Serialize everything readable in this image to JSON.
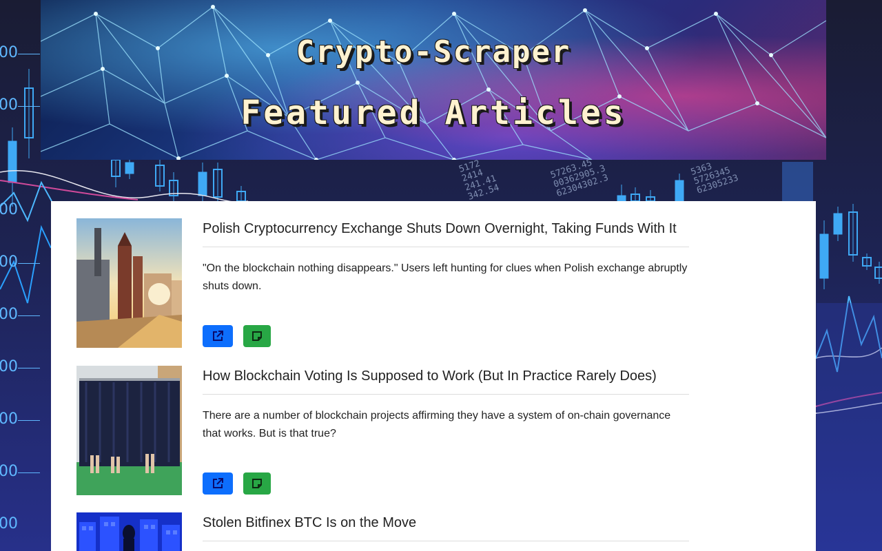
{
  "banner": {
    "line1": "Crypto-Scraper",
    "line2": "Featured Articles"
  },
  "background": {
    "axis_labels": [
      "00",
      "00",
      "00",
      "00",
      "00",
      "00",
      "00",
      "00",
      "00"
    ],
    "number_columns": [
      "5172\n2414\n241.41\n342.54",
      "57263.45\n00362905.3\n62304302.3",
      "5363\n5726345\n62305233"
    ]
  },
  "articles": [
    {
      "title": "Polish Cryptocurrency Exchange Shuts Down Overnight, Taking Funds With It",
      "description": "\"On the blockchain nothing disappears.\" Users left hunting for clues when Polish exchange abruptly shuts down.",
      "open_icon": "external-link-icon",
      "note_icon": "sticky-note-icon"
    },
    {
      "title": "How Blockchain Voting Is Supposed to Work (But In Practice Rarely Does)",
      "description": "There are a number of blockchain projects affirming they have a system of on-chain governance that works. But is that true?",
      "open_icon": "external-link-icon",
      "note_icon": "sticky-note-icon"
    },
    {
      "title": "Stolen Bitfinex BTC Is on the Move",
      "description": "",
      "open_icon": "external-link-icon",
      "note_icon": "sticky-note-icon"
    }
  ],
  "colors": {
    "open_button": "#0d6efd",
    "note_button": "#28a745",
    "card": "#ffffff"
  }
}
